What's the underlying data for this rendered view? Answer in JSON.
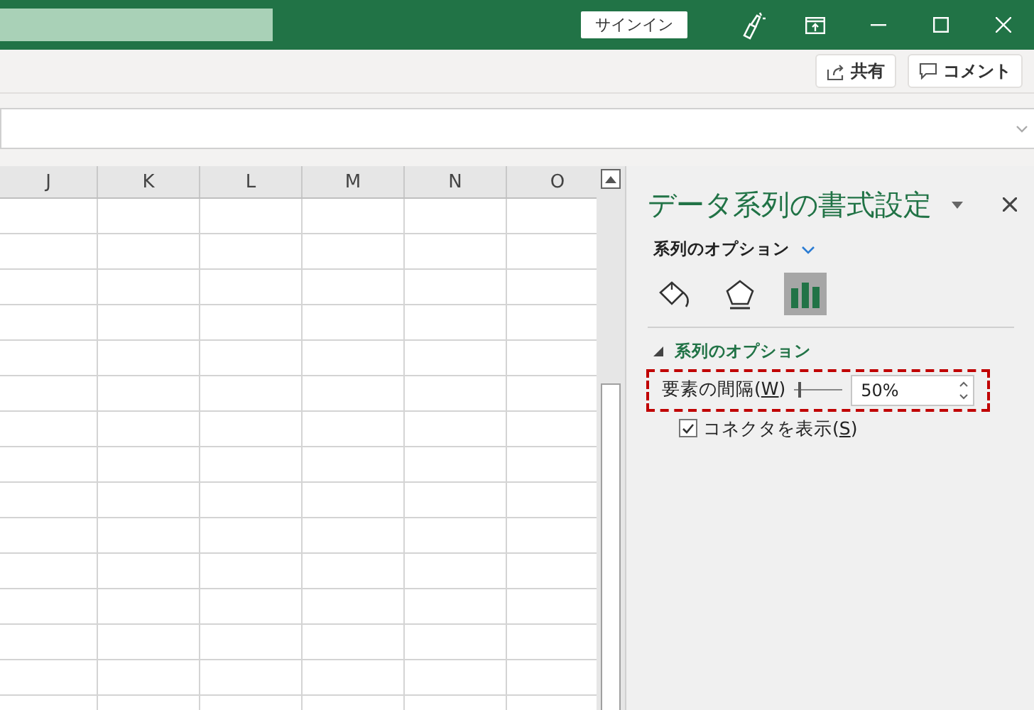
{
  "titlebar": {
    "signin": "サインイン"
  },
  "ribbon": {
    "buttons": [
      {
        "kind": "share",
        "label": "共有"
      },
      {
        "kind": "comment",
        "label": "コメント"
      }
    ]
  },
  "sheet": {
    "columns": [
      "J",
      "K",
      "L",
      "M",
      "N",
      "O"
    ]
  },
  "pane": {
    "title": "データ系列の書式設定",
    "options_label": "系列のオプション",
    "tabs": [
      {
        "kind": "fill",
        "selected": false
      },
      {
        "kind": "effects",
        "selected": false
      },
      {
        "kind": "series",
        "selected": true
      }
    ],
    "section": {
      "title": "系列のオプション",
      "expanded": true,
      "gap": {
        "label_parts": [
          "要素の間隔(",
          "W",
          ")"
        ],
        "level": 0.1,
        "value": "50%",
        "highlighted": true
      },
      "connector": {
        "label_parts": [
          "コネクタを表示(",
          "S",
          ")"
        ],
        "checked": true
      }
    }
  }
}
